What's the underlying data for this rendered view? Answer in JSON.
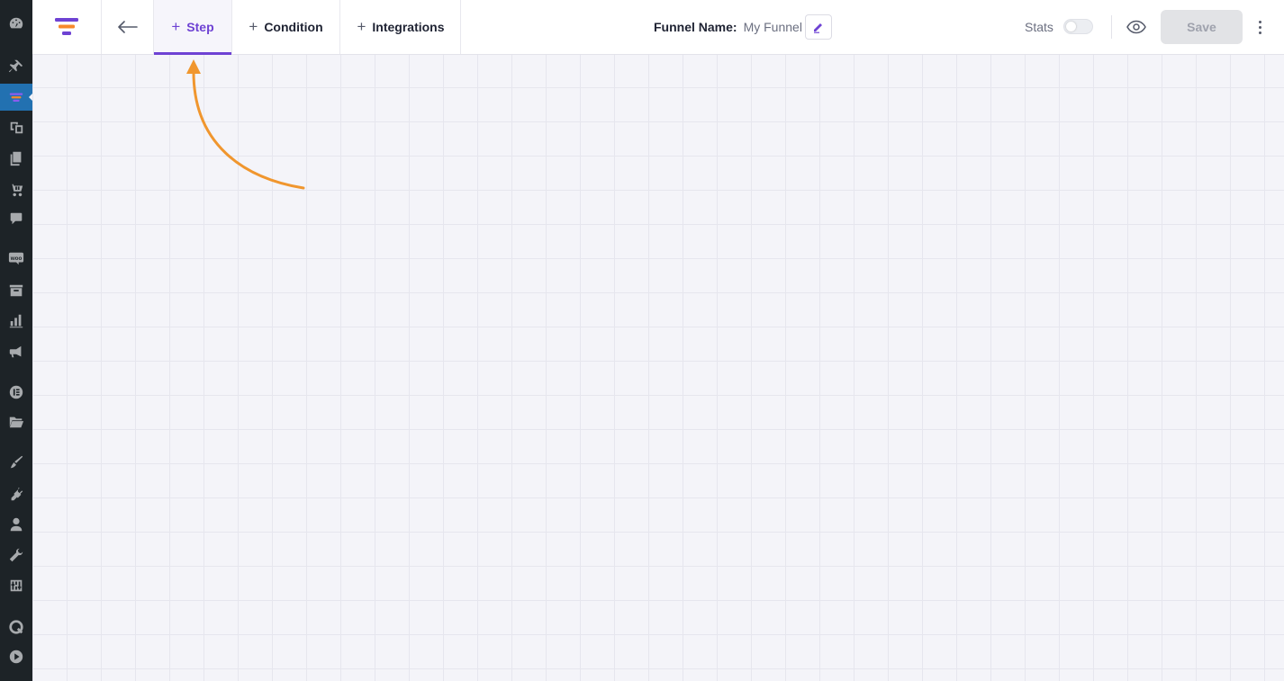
{
  "sidebar": {
    "icons": [
      "dashboard-icon",
      "pin-icon",
      "funnel-icon",
      "media-icon",
      "pages-icon",
      "cart-icon",
      "comments-icon",
      "woo-icon",
      "archive-icon",
      "analytics-icon",
      "megaphone-icon",
      "elementor-icon",
      "folder-icon",
      "brush-icon",
      "plugins-icon",
      "users-icon",
      "tools-icon",
      "settings-icon",
      "q-icon",
      "play-icon"
    ],
    "woo_label": "woo"
  },
  "toolbar": {
    "tabs": [
      {
        "label": "Step",
        "active": true
      },
      {
        "label": "Condition",
        "active": false
      },
      {
        "label": "Integrations",
        "active": false
      }
    ],
    "plus_glyph": "+",
    "funnel_name_label": "Funnel Name:",
    "funnel_name_value": "My Funnel",
    "stats_label": "Stats",
    "stats_enabled": false,
    "save_label": "Save"
  },
  "colors": {
    "accent": "#6e42d3",
    "wp_sidebar": "#1d2327",
    "wp_active": "#2271b1",
    "annotation_arrow": "#f0962e",
    "logo_purple": "#6e42d3",
    "logo_orange": "#f7892b"
  }
}
